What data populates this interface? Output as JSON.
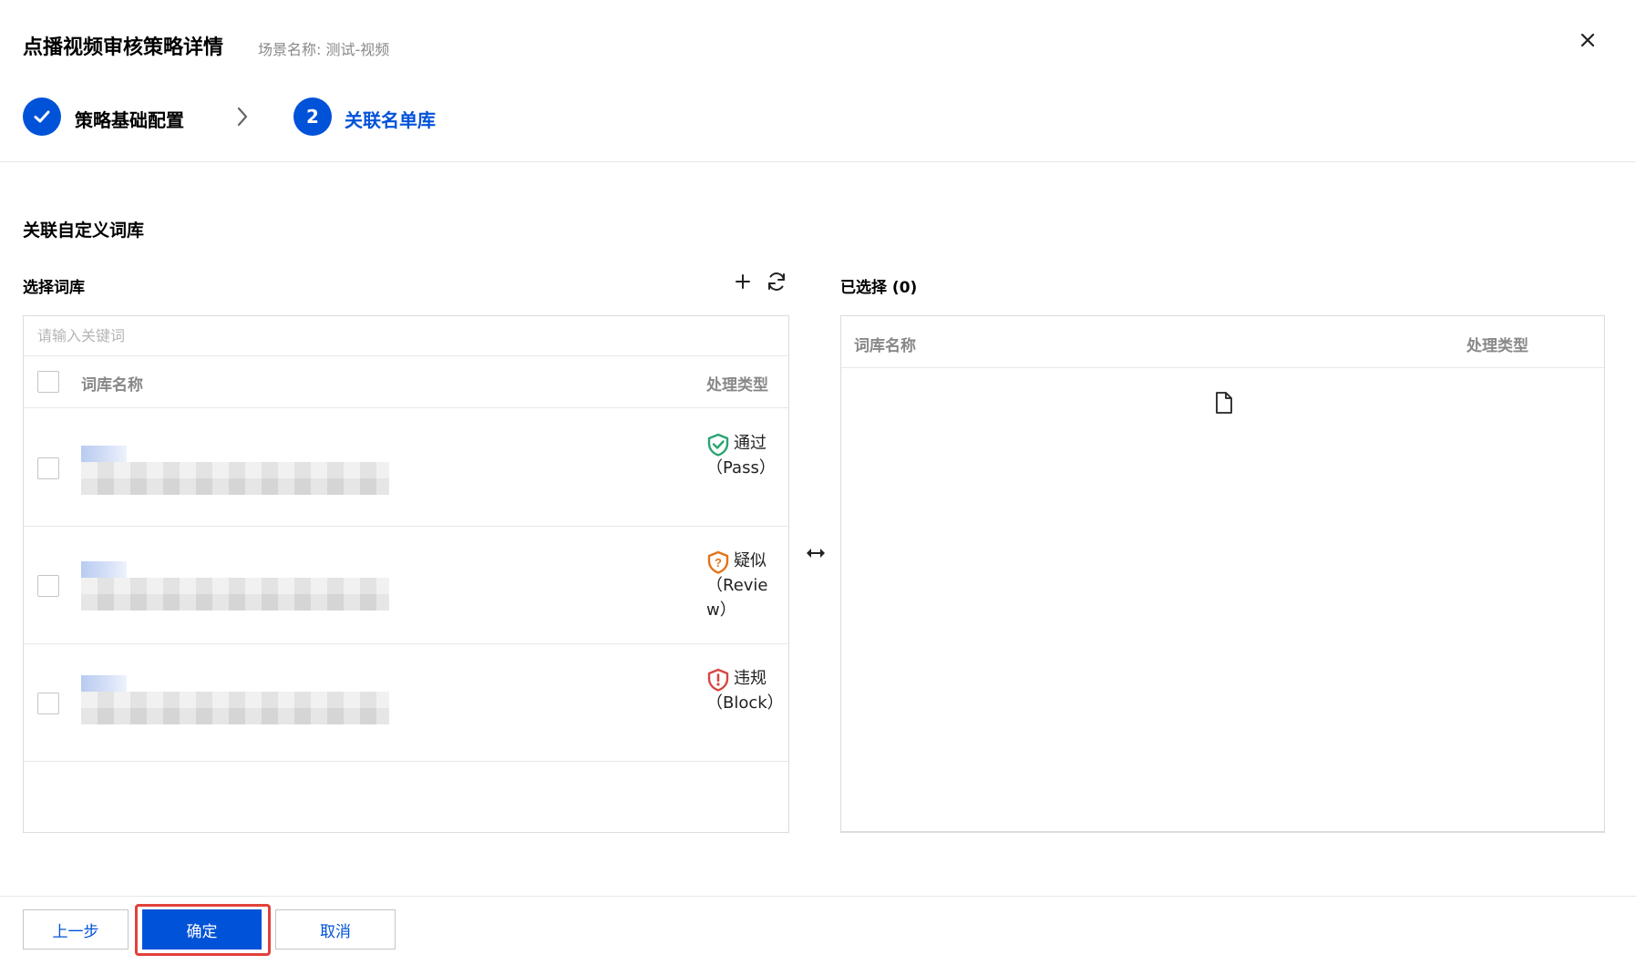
{
  "dialog": {
    "title": "点播视频审核策略详情",
    "scene": "场景名称: 测试-视频"
  },
  "steps": [
    {
      "label": "策略基础配置",
      "state": "done"
    },
    {
      "number": "2",
      "label": "关联名单库",
      "state": "active"
    }
  ],
  "section": {
    "title": "关联自定义词库"
  },
  "left": {
    "label": "选择词库",
    "search_placeholder": "请输入关键词",
    "columns": {
      "name": "词库名称",
      "type": "处理类型"
    },
    "rows": [
      {
        "type_label": "通过（Pass）",
        "type_key": "pass",
        "type_color": "#2ba471"
      },
      {
        "type_label": "疑似（Review）",
        "type_key": "review",
        "type_color": "#e37318"
      },
      {
        "type_label": "违规（Block）",
        "type_key": "block",
        "type_color": "#d54941"
      }
    ]
  },
  "right": {
    "label": "已选择 (0)",
    "columns": {
      "name": "词库名称",
      "type": "处理类型"
    }
  },
  "footer": {
    "prev_label": "上一步",
    "ok_label": "确定",
    "cancel_label": "取消"
  },
  "colors": {
    "brand": "#0052d9",
    "highlight": "#e2413b"
  }
}
